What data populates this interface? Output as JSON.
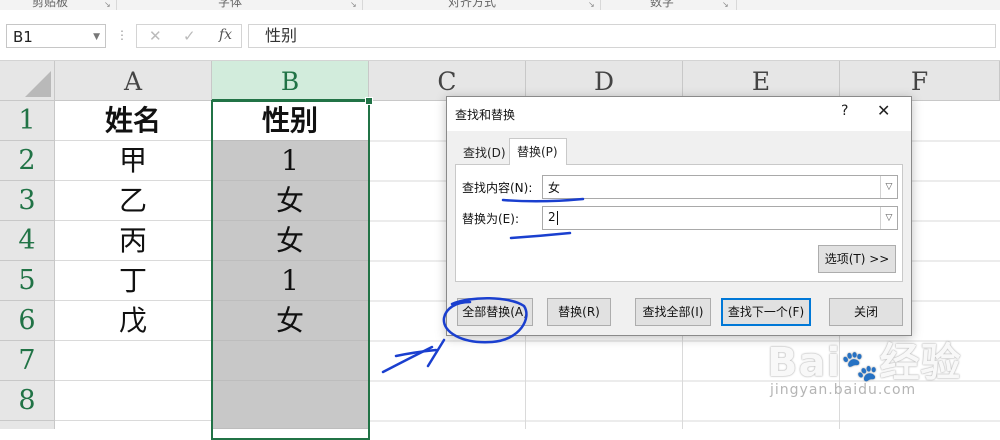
{
  "ribbon": {
    "groups": [
      "剪贴板",
      "字体",
      "对齐方式",
      "数字"
    ]
  },
  "formula_bar": {
    "name_box": "B1",
    "cancel_glyph": "✕",
    "enter_glyph": "✓",
    "fx_label": "fx",
    "content": "性别"
  },
  "sheet": {
    "columns": [
      "A",
      "B",
      "C",
      "D",
      "E",
      "F"
    ],
    "rows": [
      "1",
      "2",
      "3",
      "4",
      "5",
      "6",
      "7",
      "8"
    ],
    "cells": {
      "A": [
        "姓名",
        "甲",
        "乙",
        "丙",
        "丁",
        "戊",
        "",
        ""
      ],
      "B": [
        "性别",
        "1",
        "女",
        "女",
        "1",
        "女",
        "",
        ""
      ]
    },
    "selected_column": "B",
    "active_cell": "B1"
  },
  "dialog": {
    "title": "查找和替换",
    "help": "?",
    "close": "✕",
    "tabs": [
      "查找(D)",
      "替换(P)"
    ],
    "active_tab": "替换(P)",
    "find_label": "查找内容(N):",
    "find_value": "女",
    "replace_label": "替换为(E):",
    "replace_value": "2",
    "options_button": "选项(T) >>",
    "buttons": {
      "replace_all": "全部替换(A)",
      "replace": "替换(R)",
      "find_all": "查找全部(I)",
      "find_next": "查找下一个(F)",
      "close": "关闭"
    }
  },
  "watermark": {
    "logo": "Bai du 经验",
    "url": "jingyan.baidu.com"
  },
  "colors": {
    "selection_green": "#217346",
    "annotation_blue": "#1a3fcf",
    "primary_button_border": "#0078d7"
  }
}
